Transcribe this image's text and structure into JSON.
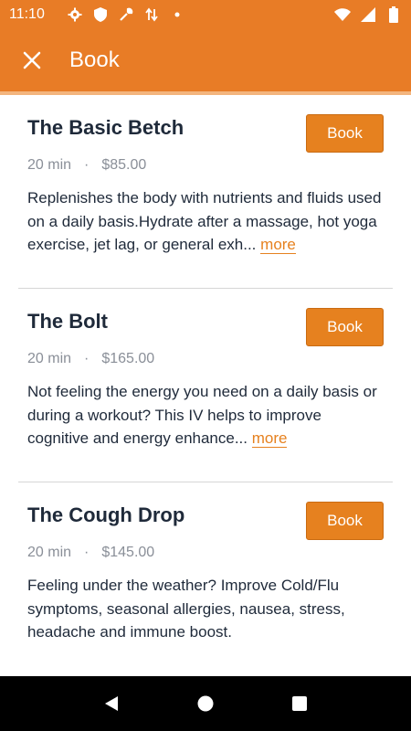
{
  "status_bar": {
    "time": "11:10",
    "icons_left": [
      "gear-icon",
      "shield-icon",
      "wrench-icon",
      "data-transfer-icon",
      "dot-icon"
    ],
    "icons_right": [
      "wifi-icon",
      "signal-icon",
      "battery-icon"
    ]
  },
  "app_bar": {
    "title": "Book",
    "close_icon": "close-icon"
  },
  "colors": {
    "primary": "#e87c26",
    "button": "#e6811f",
    "text_dark": "#1f2a3a",
    "text_muted": "#8a8f98"
  },
  "services": [
    {
      "name": "The Basic Betch",
      "duration": "20 min",
      "separator": "·",
      "price": "$85.00",
      "button_label": "Book",
      "description": "Replenishes the body with nutrients and fluids used on a daily basis.Hydrate after a massage, hot yoga exercise, jet lag, or general exh...",
      "more_label": "more"
    },
    {
      "name": "The Bolt",
      "duration": "20 min",
      "separator": "·",
      "price": "$165.00",
      "button_label": "Book",
      "description": "Not feeling the energy you need on a daily basis or during a workout? This IV helps to improve cognitive and energy enhance...",
      "more_label": "more"
    },
    {
      "name": "The Cough Drop",
      "duration": "20 min",
      "separator": "·",
      "price": "$145.00",
      "button_label": "Book",
      "description": "Feeling under the weather? Improve Cold/Flu symptoms, seasonal allergies, nausea, stress, headache and immune boost."
    }
  ],
  "nav_bar": {
    "buttons": [
      "back-icon",
      "home-icon",
      "recents-icon"
    ]
  }
}
